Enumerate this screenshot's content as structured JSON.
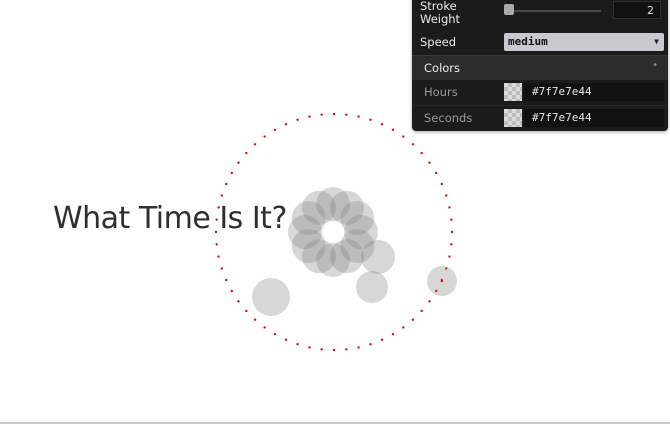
{
  "page": {
    "title": "What Time Is It?"
  },
  "gui": {
    "stroke_weight": {
      "label": "Stroke Weight",
      "value": "2",
      "level": 0.02
    },
    "speed": {
      "label": "Speed",
      "value": "medium"
    },
    "colors_folder": {
      "label": "Colors"
    },
    "hours": {
      "label": "Hours",
      "value": "#7f7e7e44"
    },
    "seconds": {
      "label": "Seconds",
      "value": "#7f7e7e44"
    }
  },
  "colors": {
    "circle_fill": "#7f7e7e44",
    "dot_color": "#cc1111",
    "panel_bg": "#1b1b1b"
  },
  "icons": {
    "speed_dropdown": "chevron-down-icon",
    "colors_toggle": "folder-toggle-icon"
  }
}
